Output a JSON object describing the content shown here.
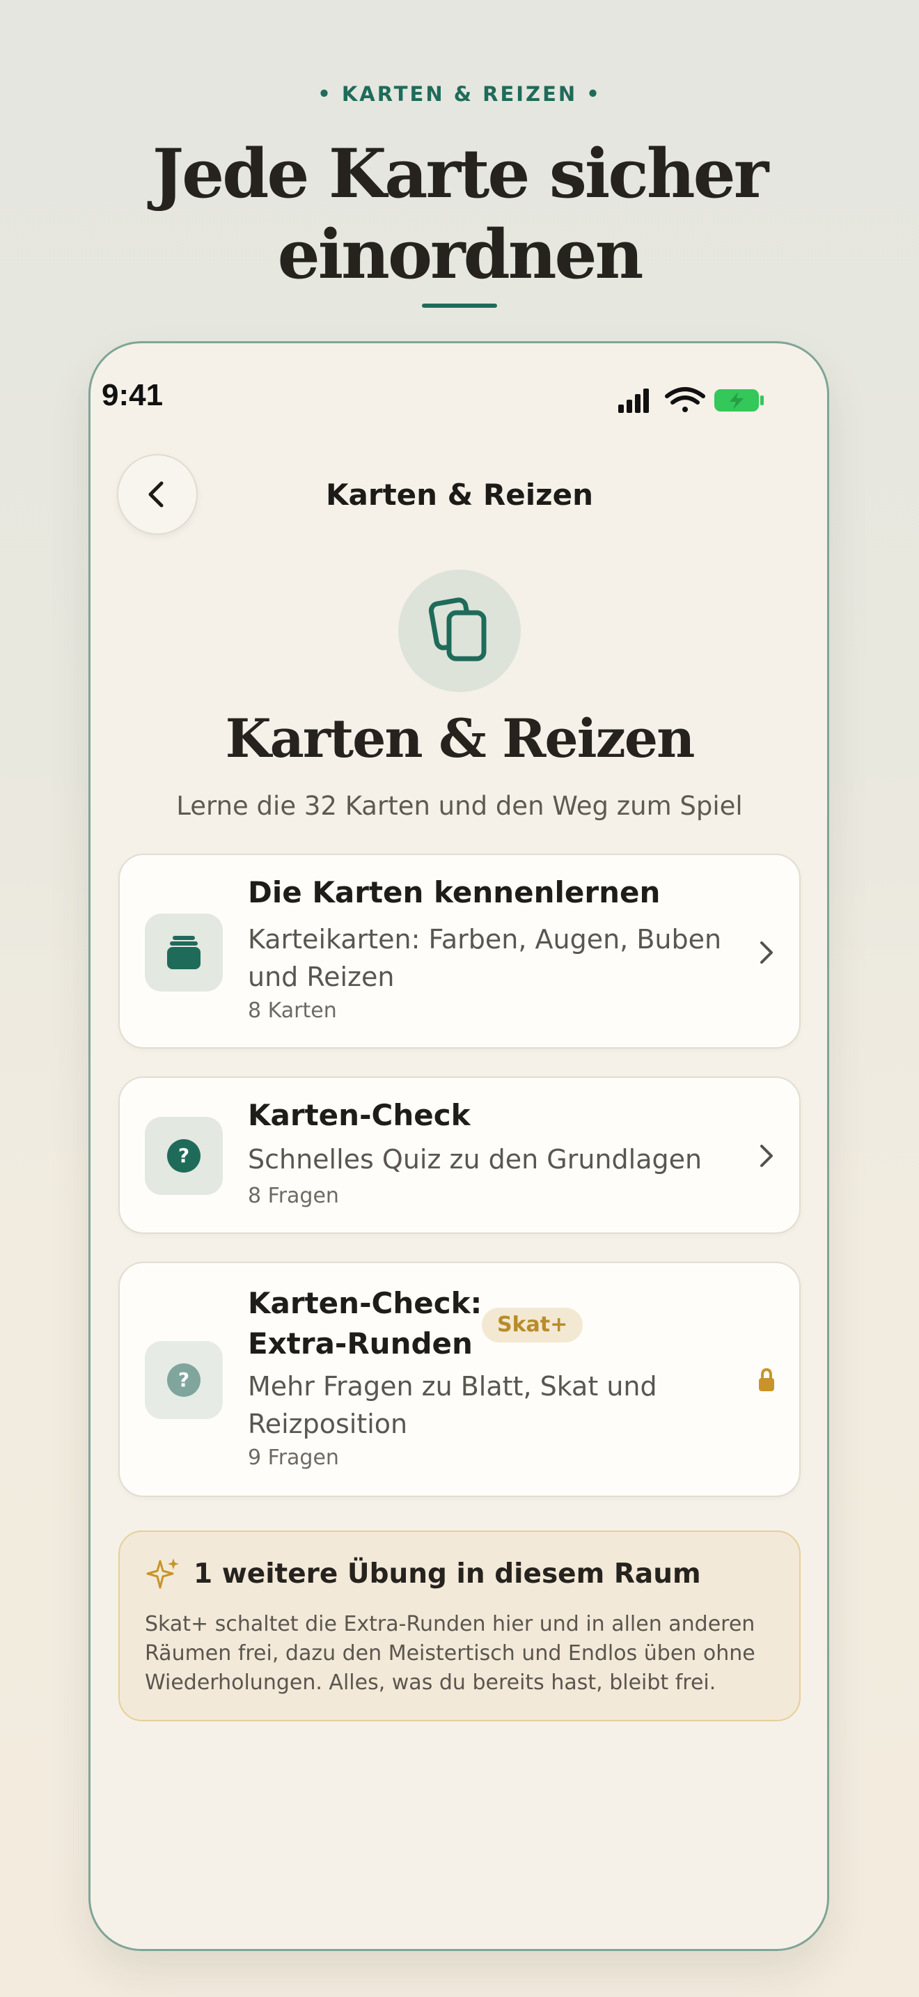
{
  "promo": {
    "eyebrow": "• KARTEN & REIZEN •",
    "headline_line1": "Jede Karte sicher",
    "headline_line2": "einordnen"
  },
  "status_bar": {
    "time": "9:41",
    "icons": [
      "signal-icon",
      "wifi-icon",
      "battery-charging-icon"
    ]
  },
  "nav": {
    "title": "Karten & Reizen",
    "back_icon": "chevron-left-icon"
  },
  "hero": {
    "icon": "cards-stack-icon",
    "title": "Karten & Reizen",
    "subtitle": "Lerne die 32 Karten und den Weg zum Spiel"
  },
  "lessons": [
    {
      "title": "Die Karten kennenlernen",
      "desc_line1": "Karteikarten: Farben, Augen, Buben",
      "desc_line2": "und Reizen",
      "meta": "8 Karten",
      "icon": "card-deck-icon",
      "trailing": "chevron-right-icon"
    },
    {
      "title": "Karten-Check",
      "desc_line1": "Schnelles Quiz zu den Grundlagen",
      "meta": "8 Fragen",
      "icon": "question-icon",
      "trailing": "chevron-right-icon"
    },
    {
      "title_line1": "Karten-Check:",
      "title_line2": "Extra-Runden",
      "badge": "Skat+",
      "desc_line1": "Mehr Fragen zu Blatt, Skat und",
      "desc_line2": "Reizposition",
      "meta": "9 Fragen",
      "icon": "question-icon",
      "trailing": "lock-icon"
    }
  ],
  "upsell": {
    "icon": "sparkle-icon",
    "title": "1 weitere Übung in diesem Raum",
    "body_line1": "Skat+ schaltet die Extra-Runden hier und in allen anderen",
    "body_line2": "Räumen frei, dazu den Meistertisch und Endlos üben ohne",
    "body_line3": "Wiederholungen. Alles, was du bereits hast, bleibt frei."
  },
  "colors": {
    "accent": "#1f6b5a",
    "gold": "#c8942a",
    "background": "#f5f1e8",
    "battery": "#34c759"
  }
}
